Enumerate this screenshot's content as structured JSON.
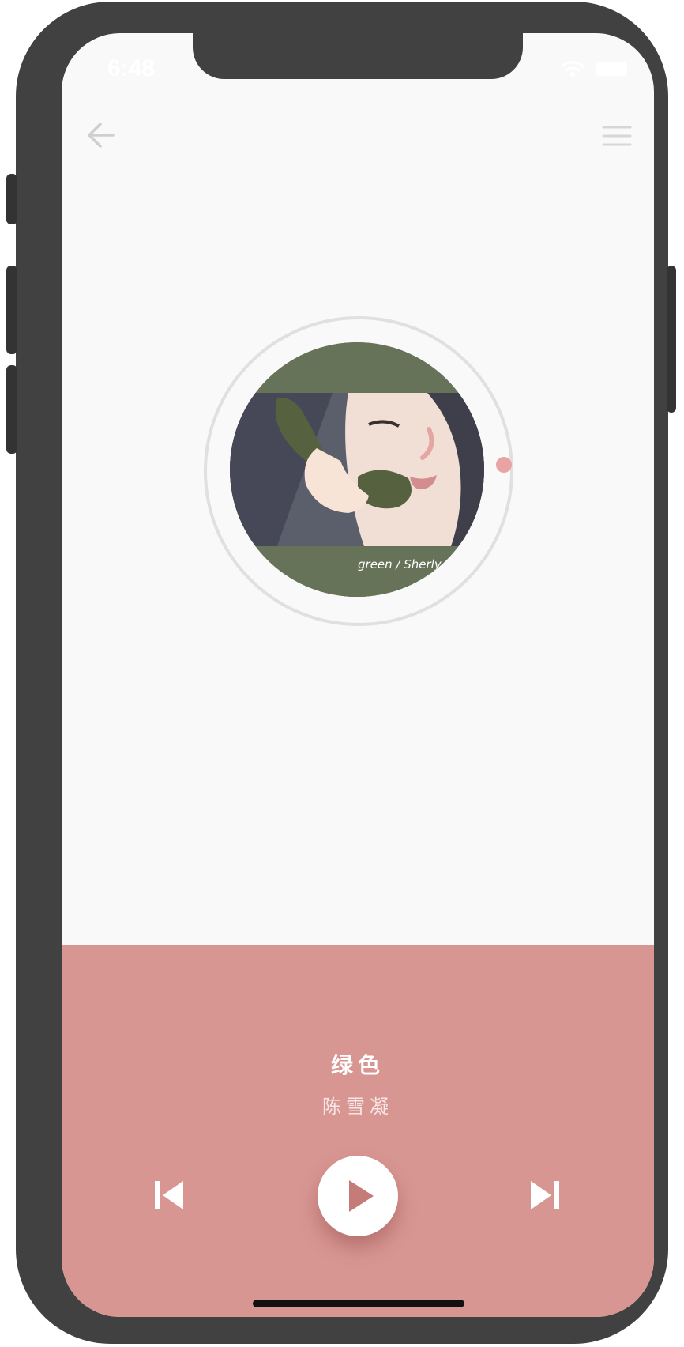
{
  "status_bar": {
    "time": "6:48"
  },
  "header": {
    "back_icon": "arrow-left-icon",
    "menu_icon": "hamburger-menu-icon"
  },
  "album_art": {
    "caption": "green / Sherly"
  },
  "now_playing": {
    "title": "绿色",
    "artist": "陈雪凝",
    "progress": 0.0
  },
  "controls": {
    "previous_icon": "skip-previous-icon",
    "play_icon": "play-icon",
    "next_icon": "skip-next-icon"
  },
  "colors": {
    "accent": "#d89692",
    "background": "#f9f9f9",
    "cover_green": "#667358",
    "progress_dot": "#eaa3a3",
    "play_triangle": "#c57b77"
  }
}
